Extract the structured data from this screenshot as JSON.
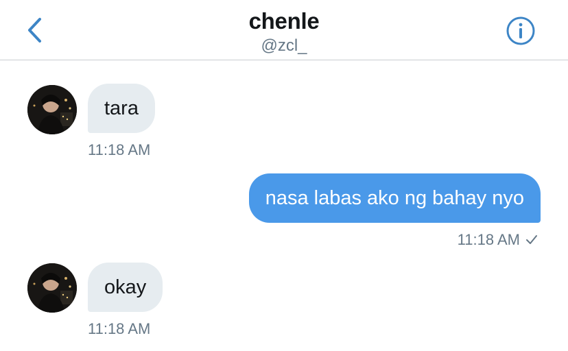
{
  "header": {
    "title": "chenle",
    "handle": "@zcl_",
    "back_icon": "chevron-left-icon",
    "info_icon": "info-circle-icon",
    "accent_color": "#3d85c6"
  },
  "messages": [
    {
      "direction": "incoming",
      "text": "tara",
      "time": "11:18 AM"
    },
    {
      "direction": "outgoing",
      "text": "nasa labas ako ng bahay nyo",
      "time": "11:18 AM",
      "status_icon": "checkmark-icon"
    },
    {
      "direction": "incoming",
      "text": "okay",
      "time": "11:18 AM"
    }
  ],
  "colors": {
    "incoming_bubble": "#e6ecf0",
    "outgoing_bubble": "#4a99e9",
    "meta_text": "#657786"
  }
}
